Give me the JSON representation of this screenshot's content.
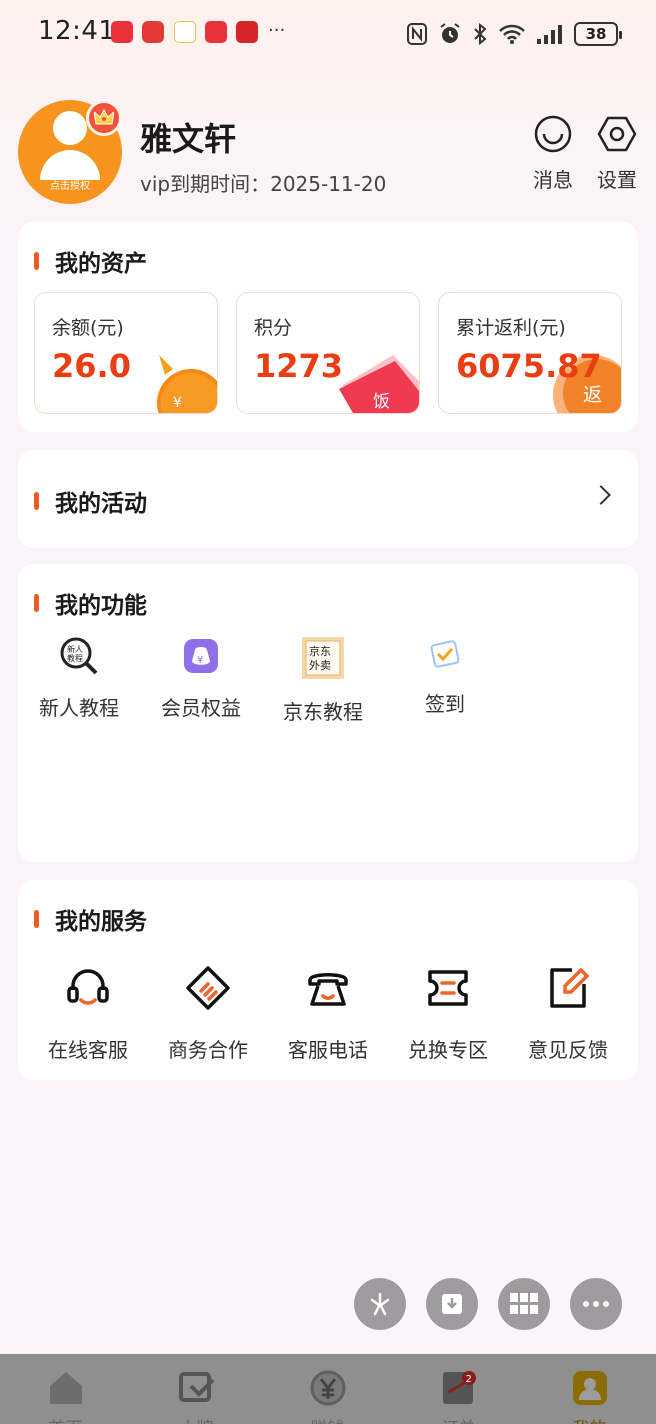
{
  "status_bar": {
    "time": "12:41",
    "battery": "38",
    "more": "···"
  },
  "profile": {
    "name": "雅文轩",
    "vip_label": "vip到期时间：",
    "vip_date": "2025-11-20",
    "avatar_tag": "点击授权",
    "message_label": "消息",
    "settings_label": "设置"
  },
  "assets": {
    "title": "我的资产",
    "items": [
      {
        "label": "余额(元)",
        "value": "26.0",
        "badge": "¥"
      },
      {
        "label": "积分",
        "value": "1273",
        "badge": "饭"
      },
      {
        "label": "累计返利(元)",
        "value": "6075.87",
        "badge": "返"
      }
    ]
  },
  "activities": {
    "title": "我的活动"
  },
  "functions": {
    "title": "我的功能",
    "items": [
      {
        "label": "新人教程",
        "icon_text": "新人教程"
      },
      {
        "label": "会员权益",
        "icon_text": "¥"
      },
      {
        "label": "京东教程",
        "icon_text": "京东外卖"
      },
      {
        "label": "签到"
      }
    ]
  },
  "services": {
    "title": "我的服务",
    "items": [
      {
        "label": "在线客服"
      },
      {
        "label": "商务合作"
      },
      {
        "label": "客服电话"
      },
      {
        "label": "兑换专区"
      },
      {
        "label": "意见反馈"
      }
    ]
  },
  "tabbar": {
    "items": [
      {
        "label": "首页"
      },
      {
        "label": "大牌"
      },
      {
        "label": "赚钱"
      },
      {
        "label": "订单",
        "badge": "2"
      },
      {
        "label": "我的"
      }
    ]
  },
  "colors": {
    "accent": "#ea3d12",
    "avatar": "#f7941d",
    "title_bar": "#ee5a24",
    "active_tab": "#f5c400"
  }
}
